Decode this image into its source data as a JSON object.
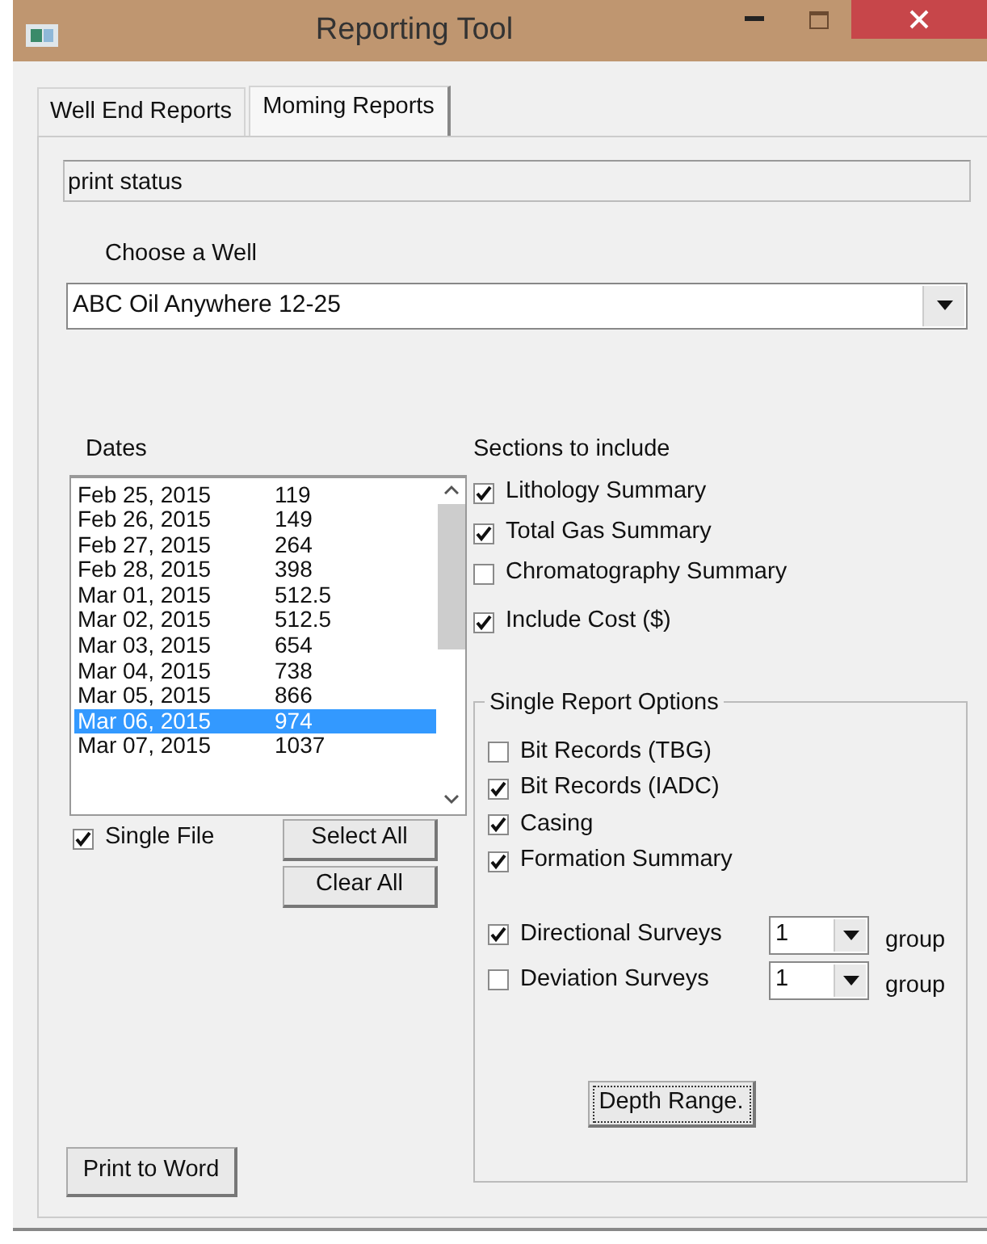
{
  "window": {
    "title": "Reporting Tool"
  },
  "tabs": [
    {
      "label": "Well End Reports",
      "selected": false
    },
    {
      "label": "Moming Reports",
      "selected": true
    }
  ],
  "status_field": {
    "value": "print status"
  },
  "well": {
    "label": "Choose a Well",
    "value": "ABC Oil Anywhere 12-25"
  },
  "dates": {
    "label": "Dates",
    "rows": [
      {
        "date": "Feb 25, 2015",
        "depth": "119",
        "selected": false
      },
      {
        "date": "Feb 26, 2015",
        "depth": "149",
        "selected": false
      },
      {
        "date": "Feb 27, 2015",
        "depth": "264",
        "selected": false
      },
      {
        "date": "Feb 28, 2015",
        "depth": "398",
        "selected": false
      },
      {
        "date": "Mar 01, 2015",
        "depth": "512.5",
        "selected": false
      },
      {
        "date": "Mar 02, 2015",
        "depth": "512.5",
        "selected": false
      },
      {
        "date": "Mar 03, 2015",
        "depth": "654",
        "selected": false
      },
      {
        "date": "Mar 04, 2015",
        "depth": "738",
        "selected": false
      },
      {
        "date": "Mar 05, 2015",
        "depth": "866",
        "selected": false
      },
      {
        "date": "Mar 06, 2015",
        "depth": "974",
        "selected": true
      },
      {
        "date": "Mar 07, 2015",
        "depth": "1037",
        "selected": false
      }
    ],
    "single_file": {
      "label": "Single File",
      "checked": true
    },
    "buttons": [
      "Select All",
      "Clear All"
    ]
  },
  "sections": {
    "label": "Sections to include",
    "items": [
      {
        "label": "Lithology Summary",
        "checked": true
      },
      {
        "label": "Total Gas Summary",
        "checked": true
      },
      {
        "label": "Chromatography Summary",
        "checked": false
      },
      {
        "label": "Include Cost ($)",
        "checked": true
      }
    ]
  },
  "single_report_options": {
    "label": "Single Report Options",
    "items": [
      {
        "kind": "check",
        "label": "Bit Records (TBG)",
        "checked": false
      },
      {
        "kind": "check",
        "label": "Bit Records (IADC)",
        "checked": true
      },
      {
        "kind": "check",
        "label": "Casing",
        "checked": true
      },
      {
        "kind": "check",
        "label": "Formation Summary",
        "checked": true
      },
      {
        "kind": "survey",
        "label": "Directional Surveys",
        "checked": true,
        "count": "1",
        "unit": "group"
      },
      {
        "kind": "survey",
        "label": "Deviation Surveys",
        "checked": false,
        "count": "1",
        "unit": "group"
      }
    ],
    "button": "Depth Range."
  },
  "print_button": "Print to Word"
}
